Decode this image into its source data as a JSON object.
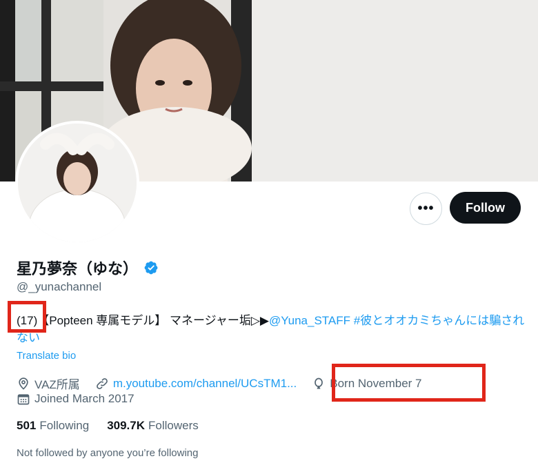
{
  "profile": {
    "display_name": "星乃夢奈（ゆな）",
    "handle": "@_yunachannel",
    "verified_icon": "verified-badge-icon",
    "accent_color": "#1d9bf0"
  },
  "actions": {
    "more_label": "•••",
    "follow_label": "Follow"
  },
  "bio": {
    "age": "(17)",
    "text": "【Popteen 専属モデル】 マネージャー垢▷▶",
    "mention": "@Yuna_STAFF",
    "space": " ",
    "hashtag": "#彼とオオカミちゃんには騙されない"
  },
  "translate_label": "Translate bio",
  "meta": {
    "location": "VAZ所属",
    "website": "m.youtube.com/channel/UCsTM1...",
    "birthday": "Born November 7",
    "joined": "Joined March 2017"
  },
  "stats": {
    "following_count": "501",
    "following_label": "Following",
    "followers_count": "309.7K",
    "followers_label": "Followers"
  },
  "social_context": "Not followed by anyone you’re following",
  "highlight_color": "#e0261a"
}
